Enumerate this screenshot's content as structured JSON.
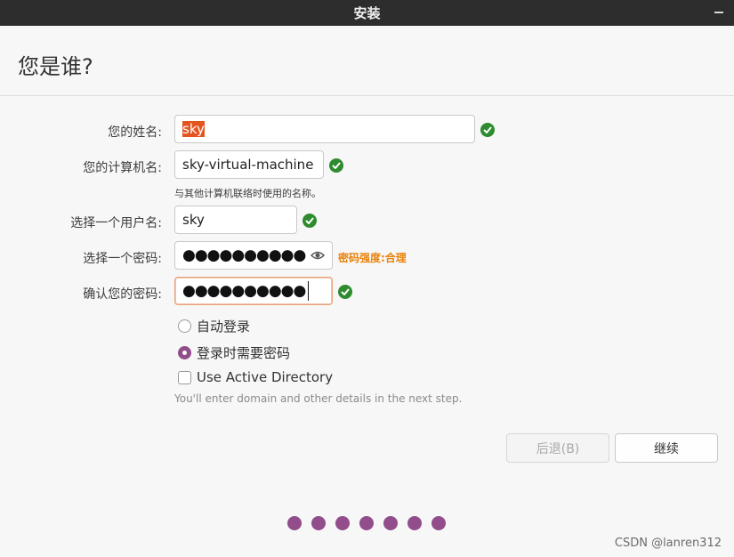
{
  "window": {
    "title": "安装"
  },
  "page": {
    "title": "您是谁?"
  },
  "form": {
    "name": {
      "label": "您的姓名:",
      "value": "sky"
    },
    "computer": {
      "label": "您的计算机名:",
      "value": "sky-virtual-machine",
      "hint": "与其他计算机联络时使用的名称。"
    },
    "username": {
      "label": "选择一个用户名:",
      "value": "sky"
    },
    "password": {
      "label": "选择一个密码:",
      "value": "●●●●●●●●●●",
      "strength": "密码强度:合理"
    },
    "confirm": {
      "label": "确认您的密码:",
      "value": "●●●●●●●●●●"
    }
  },
  "options": {
    "auto_login": "自动登录",
    "require_password": "登录时需要密码",
    "active_directory": "Use Active Directory",
    "ad_hint": "You'll enter domain and other details in the next step.",
    "selected": "require_password"
  },
  "buttons": {
    "back": "后退(B)",
    "continue": "继续"
  },
  "progress": {
    "steps": 7
  },
  "watermark": "CSDN @lanren312",
  "colors": {
    "accent": "#924d8b",
    "ok": "#2e8b2e",
    "selection": "#e4541f",
    "strength": "#e8820c"
  },
  "icons": {
    "valid": "check-circle-icon",
    "reveal": "eye-icon"
  }
}
